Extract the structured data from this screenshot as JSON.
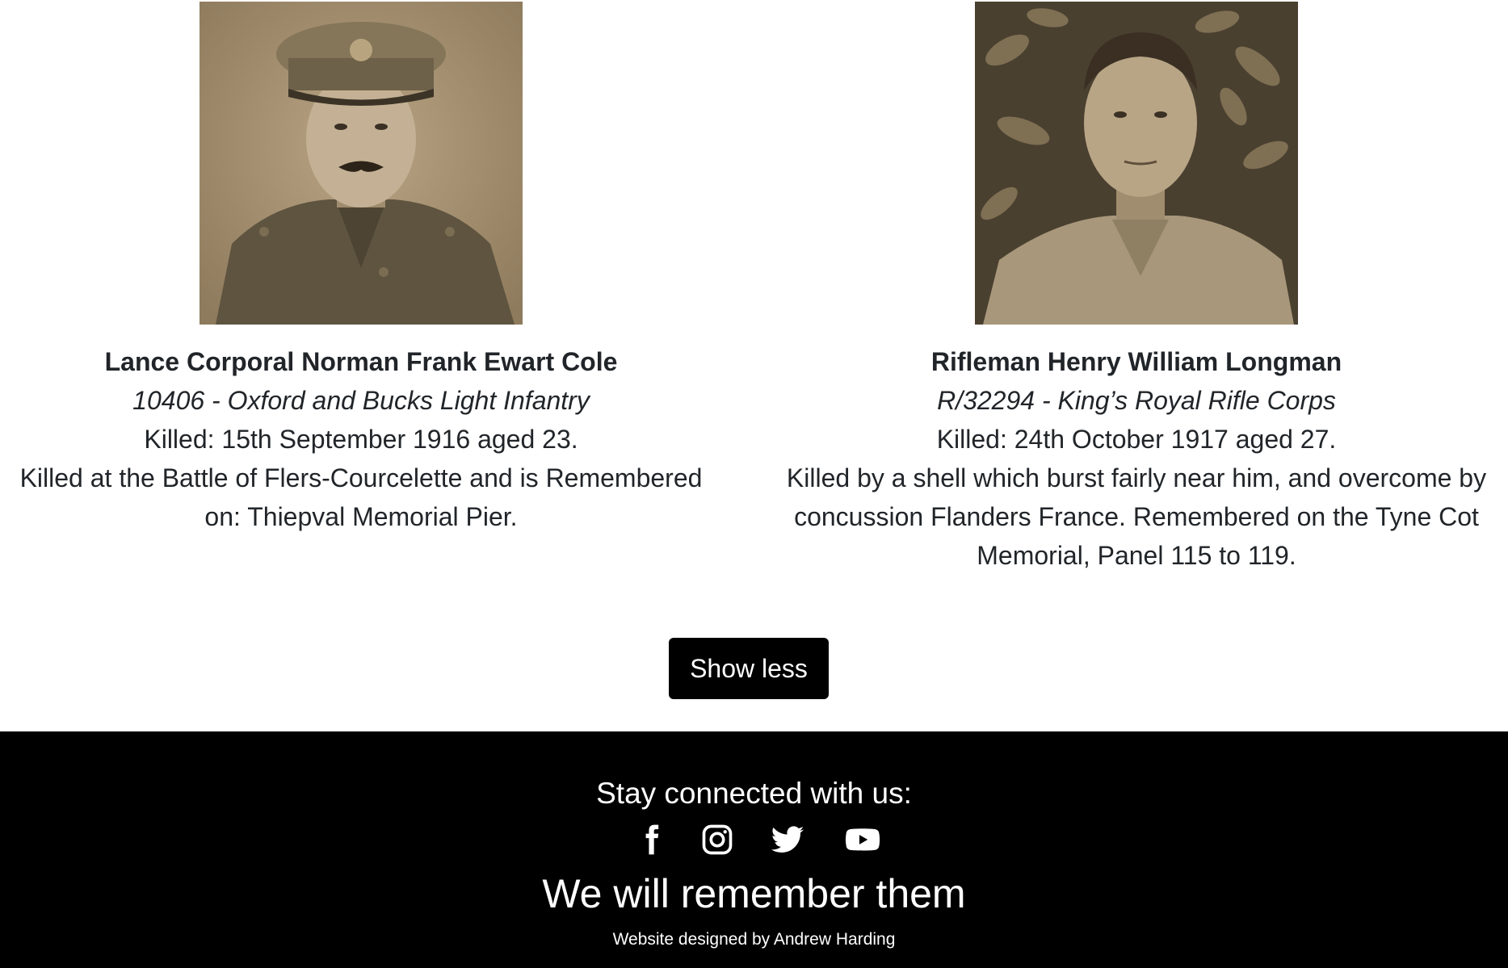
{
  "soldiers": [
    {
      "name": "Lance Corporal Norman Frank Ewart Cole",
      "unit": "10406 - Oxford and Bucks Light Infantry",
      "killed": "Killed: 15th September 1916 aged 23.",
      "description": "Killed at the Battle of Flers-Courcelette and is Remembered on: Thiepval Memorial Pier."
    },
    {
      "name": "Rifleman Henry William Longman",
      "unit": "R/32294 - King’s Royal Rifle Corps",
      "killed": "Killed: 24th October 1917 aged 27.",
      "description": "Killed by a shell which burst fairly near him, and overcome by concussion Flanders France. Remembered on the Tyne Cot Memorial, Panel 115 to 119."
    }
  ],
  "show_less_label": "Show less",
  "footer": {
    "stay_connected": "Stay connected with us:",
    "social_icons": [
      "facebook-icon",
      "instagram-icon",
      "twitter-icon",
      "youtube-icon"
    ],
    "motto": "We will remember them",
    "credit": "Website designed by Andrew Harding"
  },
  "colors": {
    "background": "#ffffff",
    "text": "#212529",
    "footer_background": "#000000",
    "footer_text": "#ffffff",
    "button_background": "#000000"
  }
}
